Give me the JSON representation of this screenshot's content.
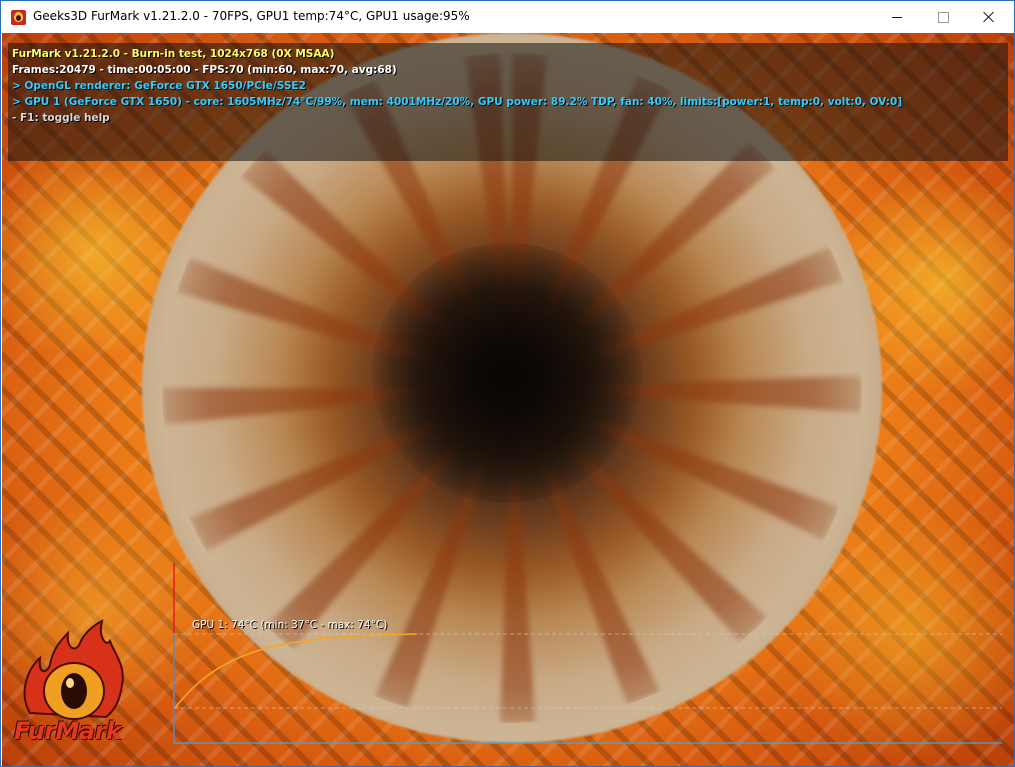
{
  "window": {
    "title": "Geeks3D FurMark v1.21.2.0 - 70FPS, GPU1 temp:74°C, GPU1 usage:95%",
    "icon": "furmark-app-icon",
    "controls": {
      "minimize_icon": "minimize-icon",
      "maximize_icon": "maximize-icon",
      "close_icon": "close-icon"
    }
  },
  "hud": {
    "line1": "FurMark v1.21.2.0 - Burn-in test, 1024x768 (0X MSAA)",
    "line2": "Frames:20479 - time:00:05:00 - FPS:70 (min:60, max:70, avg:68)",
    "line3": "> OpenGL renderer: GeForce GTX 1650/PCIe/SSE2",
    "line4": "> GPU 1 (GeForce GTX 1650) - core: 1605MHz/74°C/99%, mem: 4001MHz/20%, GPU power: 89.2% TDP, fan: 40%, limits:[power:1, temp:0, volt:0, OV:0]",
    "line5": "- F1: toggle help"
  },
  "logo": {
    "text": "FurMark"
  },
  "temp_graph": {
    "label": "GPU 1: 74°C (min: 37°C - max: 74°C)",
    "current_c": 74,
    "min_c": 37,
    "max_c": 74,
    "curve_color": "#f5a623",
    "axis_color": "#4aa3d6",
    "marker_color": "#e02020"
  },
  "colors": {
    "hud_title": "#ffff66",
    "hud_stats": "#ffffff",
    "hud_gpu": "#33ccff",
    "hud_help": "#d8d8d8"
  }
}
